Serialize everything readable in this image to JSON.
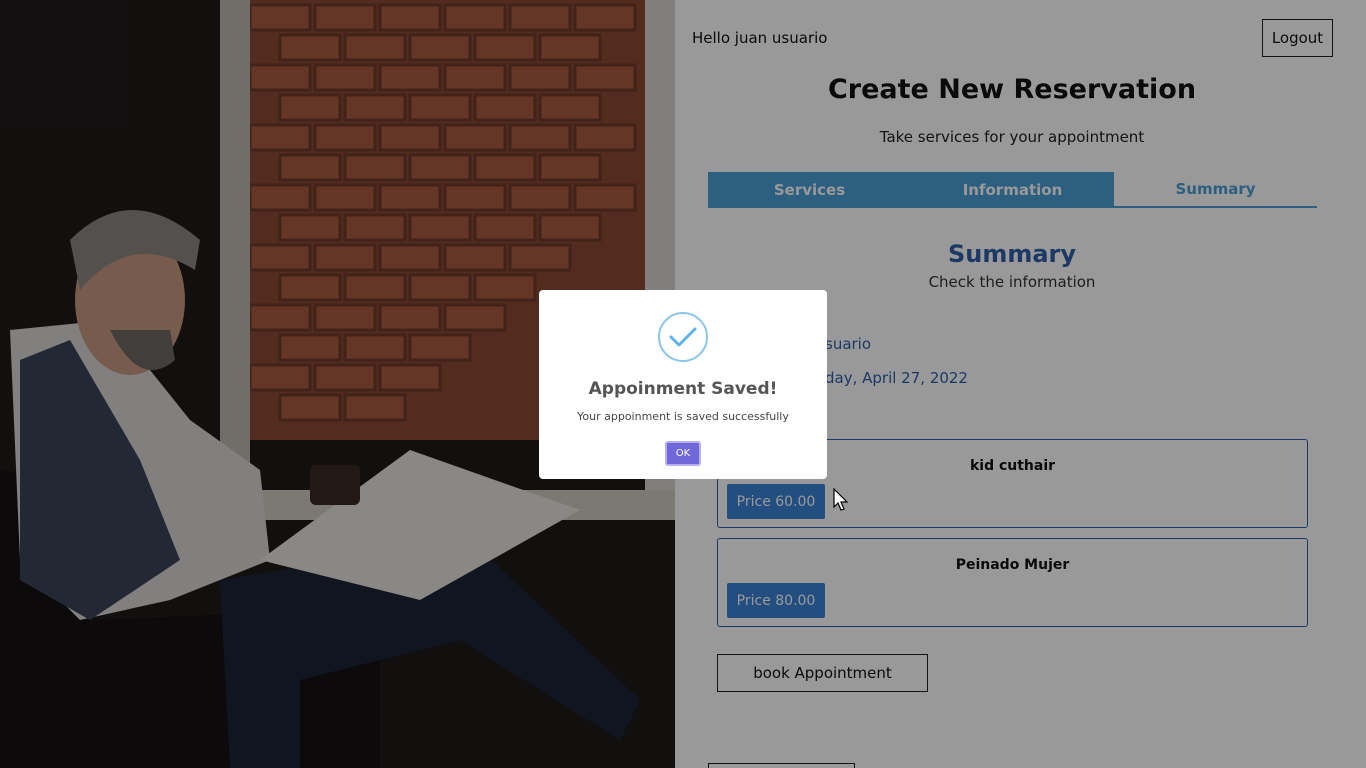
{
  "header": {
    "greeting": "Hello juan usuario",
    "logout_label": "Logout"
  },
  "page": {
    "title": "Create New Reservation",
    "subtitle": "Take services for your appointment"
  },
  "tabs": [
    {
      "label": "Services",
      "active": false
    },
    {
      "label": "Information",
      "active": false
    },
    {
      "label": "Summary",
      "active": true
    }
  ],
  "summary": {
    "title": "Summary",
    "subtitle": "Check the information",
    "name_fragment": "suario",
    "date_fragment": "day, April 27, 2022"
  },
  "services": [
    {
      "name": "kid cuthair",
      "price_label": "Price 60.00"
    },
    {
      "name": "Peinado Mujer",
      "price_label": "Price 80.00"
    }
  ],
  "book_label": "book Appointment",
  "modal": {
    "title": "Appoinment Saved!",
    "text": "Your appoinment is saved successfully",
    "ok_label": "OK",
    "icon": "check-icon"
  },
  "colors": {
    "accent": "#4b9ed6",
    "dark_blue": "#2f5fa8",
    "price_button": "#3b82d6",
    "ok_button": "#7067d8"
  }
}
